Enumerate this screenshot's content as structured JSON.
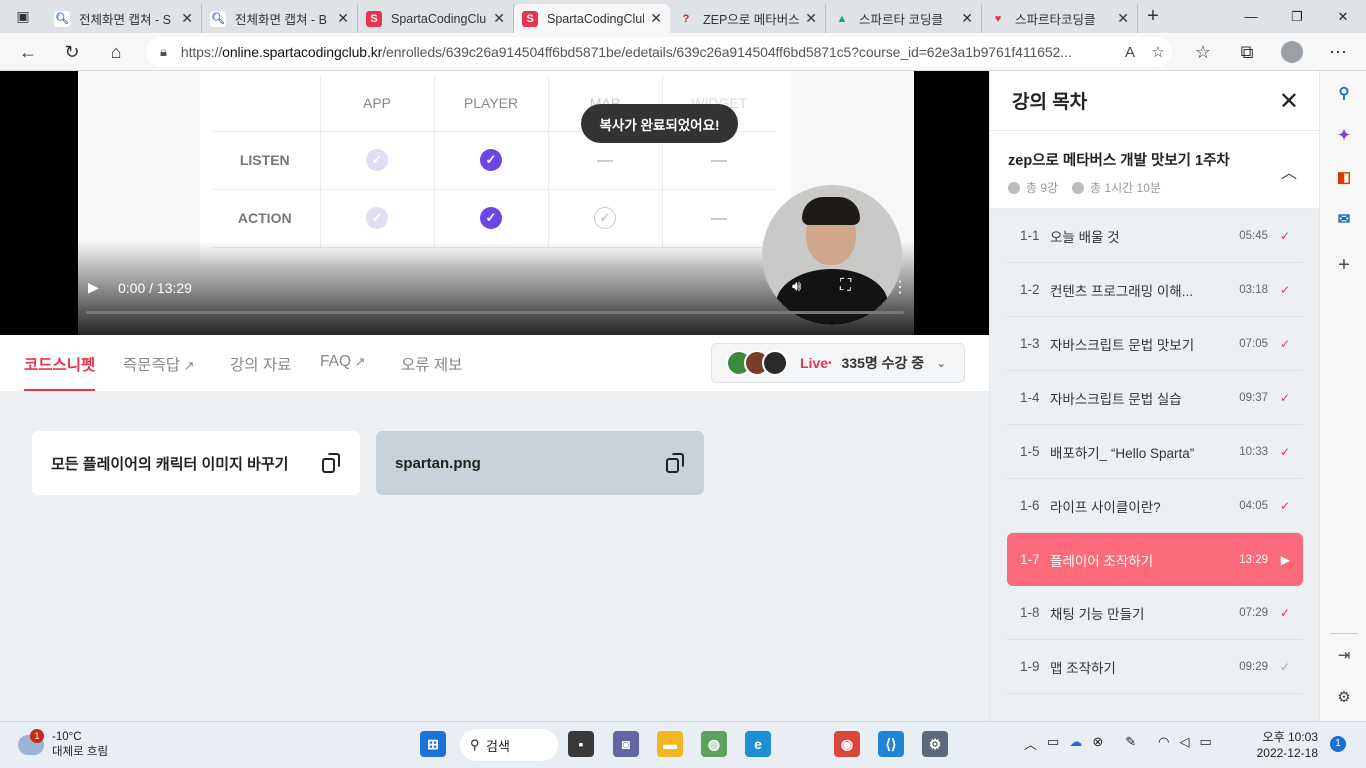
{
  "browser": {
    "tabs": [
      {
        "title": "전체화면 캡쳐 - S",
        "favicon": "search-icon"
      },
      {
        "title": "전체화면 캡쳐 - B",
        "favicon": "search-icon"
      },
      {
        "title": "SpartaCodingClub",
        "favicon": "sparta-icon"
      },
      {
        "title": "SpartaCodingClub",
        "favicon": "sparta-icon"
      },
      {
        "title": "ZEP으로 메타버스",
        "favicon": "question-icon"
      },
      {
        "title": "스파르타 코딩클",
        "favicon": "drive-icon"
      },
      {
        "title": "스파르타코딩클",
        "favicon": "heart-icon"
      }
    ],
    "url_prefix": "https://",
    "url_host": "online.spartacodingclub.kr",
    "url_path": "/enrolleds/639c26a914504ff6bd5871be/edetails/639c26a914504ff6bd5871c5?course_id=62e3a1b9761f411652..."
  },
  "video": {
    "table": {
      "headers": [
        "APP",
        "PLAYER",
        "MAP",
        "WIDGET"
      ],
      "rows": [
        {
          "label": "LISTEN",
          "cells": [
            "light-check",
            "check",
            "dash",
            "dash"
          ]
        },
        {
          "label": "ACTION",
          "cells": [
            "light-check",
            "check",
            "outline-check",
            "dash"
          ]
        }
      ]
    },
    "toast": "복사가 완료되었어요!",
    "time": "0:00 / 13:29"
  },
  "content_tabs": [
    {
      "label": "코드스니펫",
      "active": true,
      "external": false
    },
    {
      "label": "즉문즉답",
      "active": false,
      "external": true
    },
    {
      "label": "강의 자료",
      "active": false,
      "external": false
    },
    {
      "label": "FAQ",
      "active": false,
      "external": true
    },
    {
      "label": "오류 제보",
      "active": false,
      "external": false
    }
  ],
  "live": {
    "label": "Live",
    "count": "335명 수강 중"
  },
  "snippets": [
    {
      "label": "모든 플레이어의 캐릭터 이미지 바꾸기"
    },
    {
      "label": "spartan.png"
    }
  ],
  "sidebar": {
    "title": "강의 목차",
    "course_title": "zep으로 메타버스 개발 맛보기 1주차",
    "lesson_count": "총 9강",
    "total_time": "총 1시간 10분",
    "lessons": [
      {
        "no": "1-1",
        "title": "오늘 배울 것",
        "duration": "05:45",
        "state": "done"
      },
      {
        "no": "1-2",
        "title": "컨텐츠 프로그래밍 이해...",
        "duration": "03:18",
        "state": "done"
      },
      {
        "no": "1-3",
        "title": "자바스크립트 문법 맛보기",
        "duration": "07:05",
        "state": "done"
      },
      {
        "no": "1-4",
        "title": "자바스크립트 문법 실습",
        "duration": "09:37",
        "state": "done"
      },
      {
        "no": "1-5",
        "title": "배포하기_ “Hello Sparta”",
        "duration": "10:33",
        "state": "done"
      },
      {
        "no": "1-6",
        "title": "라이프 사이클이란?",
        "duration": "04:05",
        "state": "done"
      },
      {
        "no": "1-7",
        "title": "플레이어 조작하기",
        "duration": "13:29",
        "state": "current"
      },
      {
        "no": "1-8",
        "title": "채팅 기능 만들기",
        "duration": "07:29",
        "state": "done"
      },
      {
        "no": "1-9",
        "title": "맵 조작하기",
        "duration": "09:29",
        "state": "grey"
      }
    ]
  },
  "taskbar": {
    "weather_temp": "-10°C",
    "weather_desc": "대체로 흐림",
    "weather_badge": "1",
    "search_label": "검색",
    "time": "오후 10:03",
    "date": "2022-12-18",
    "notification_count": "1"
  },
  "colors": {
    "accent": "#e8344e",
    "current_lesson": "#fa6a7a",
    "check": "#6b45e6"
  }
}
